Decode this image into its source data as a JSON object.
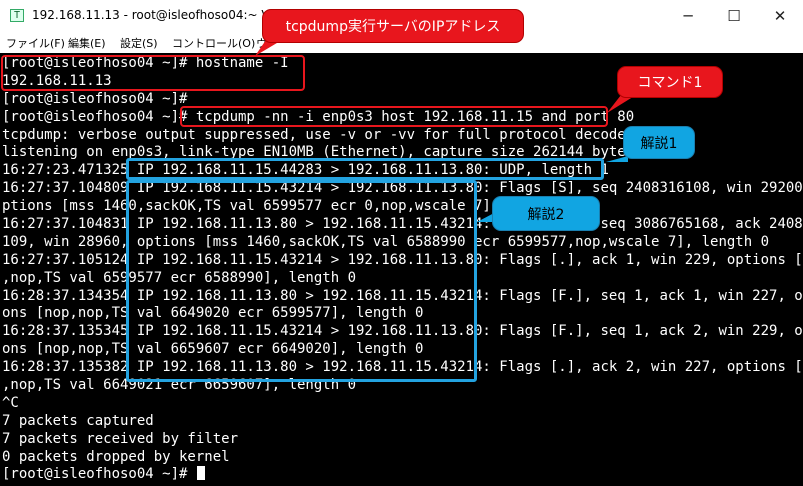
{
  "window": {
    "icon_glyph": "T",
    "title": "192.168.11.13 - root@isleofhoso04:~ VT",
    "controls": {
      "minimize": "─",
      "maximize": "☐",
      "close": "✕"
    }
  },
  "menu": [
    "ファイル(F)",
    "編集(E)",
    "設定(S)",
    "コントロール(O)",
    "ウ"
  ],
  "terminal": {
    "lines": [
      "[root@isleofhoso04 ~]# hostname -I",
      "192.168.11.13",
      "[root@isleofhoso04 ~]#",
      "[root@isleofhoso04 ~]# tcpdump -nn -i enp0s3 host 192.168.11.15 and port 80",
      "tcpdump: verbose output suppressed, use -v or -vv for full protocol decode",
      "listening on enp0s3, link-type EN10MB (Ethernet), capture size 262144 bytes",
      "16:27:23.471325 IP 192.168.11.15.44283 > 192.168.11.13.80: UDP, length 1",
      "16:27:37.104809 IP 192.168.11.15.43214 > 192.168.11.13.80: Flags [S], seq 2408316108, win 29200, o",
      "ptions [mss 1460,sackOK,TS val 6599577 ecr 0,nop,wscale 7], length 0",
      "16:27:37.104831 IP 192.168.11.13.80 > 192.168.11.15.43214: Flags [S.], seq 3086765168, ack 2408316",
      "109, win 28960, options [mss 1460,sackOK,TS val 6588990 ecr 6599577,nop,wscale 7], length 0",
      "16:27:37.105124 IP 192.168.11.15.43214 > 192.168.11.13.80: Flags [.], ack 1, win 229, options [nop",
      ",nop,TS val 6599577 ecr 6588990], length 0",
      "16:28:37.134354 IP 192.168.11.13.80 > 192.168.11.15.43214: Flags [F.], seq 1, ack 1, win 227, opti",
      "ons [nop,nop,TS val 6649020 ecr 6599577], length 0",
      "16:28:37.135345 IP 192.168.11.15.43214 > 192.168.11.13.80: Flags [F.], seq 1, ack 2, win 229, opti",
      "ons [nop,nop,TS val 6659607 ecr 6649020], length 0",
      "16:28:37.135382 IP 192.168.11.13.80 > 192.168.11.15.43214: Flags [.], ack 2, win 227, options [nop",
      ",nop,TS val 6649021 ecr 6659607], length 0",
      "^C",
      "7 packets captured",
      "7 packets received by filter",
      "0 packets dropped by kernel",
      "[root@isleofhoso04 ~]# "
    ]
  },
  "annotations": {
    "server_ip_callout": "tcpdump実行サーバのIPアドレス",
    "command_callout": "コマンド1",
    "explanation1_callout": "解説1",
    "explanation2_callout": "解説2"
  },
  "colors": {
    "red": "#e8161d",
    "blue": "#23a3e0",
    "terminal_bg": "#000000",
    "terminal_fg": "#ffffff"
  }
}
